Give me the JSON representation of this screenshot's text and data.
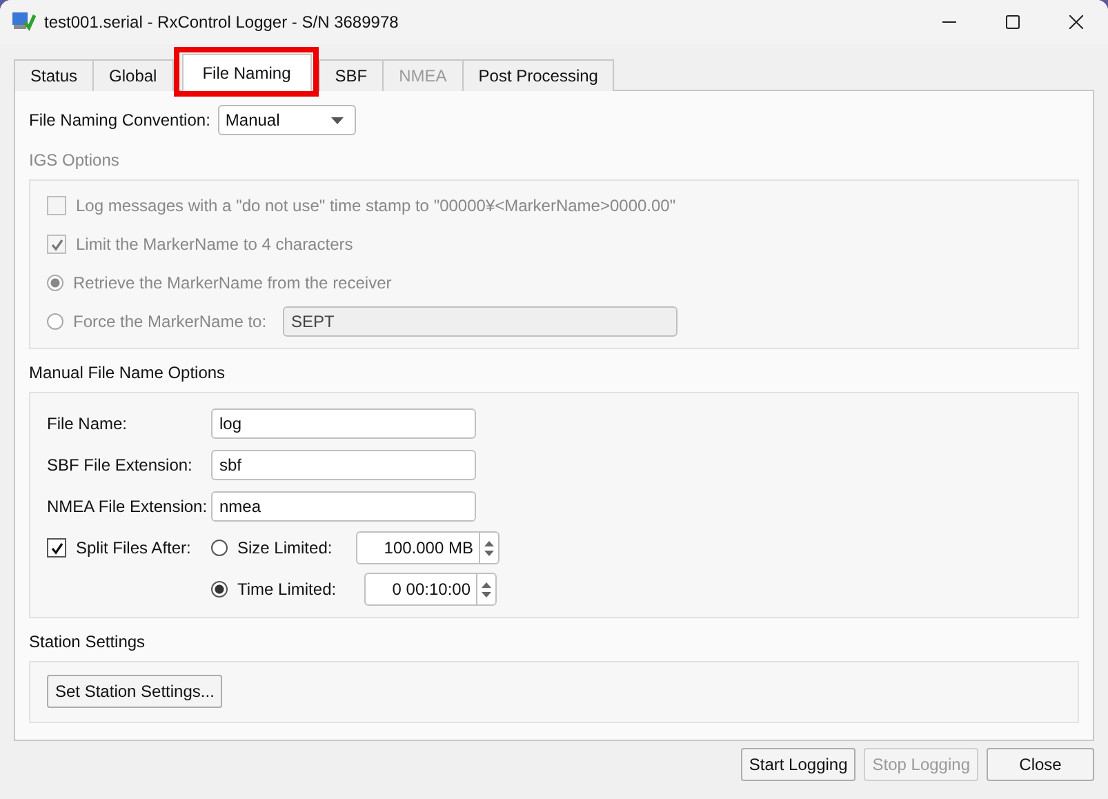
{
  "window": {
    "title": "test001.serial - RxControl Logger - S/N 3689978"
  },
  "tabs": [
    {
      "label": "Status",
      "selected": false,
      "disabled": false,
      "highlighted": false
    },
    {
      "label": "Global",
      "selected": false,
      "disabled": false,
      "highlighted": false
    },
    {
      "label": "File Naming",
      "selected": true,
      "disabled": false,
      "highlighted": true
    },
    {
      "label": "SBF",
      "selected": false,
      "disabled": false,
      "highlighted": false
    },
    {
      "label": "NMEA",
      "selected": false,
      "disabled": true,
      "highlighted": false
    },
    {
      "label": "Post Processing",
      "selected": false,
      "disabled": false,
      "highlighted": false
    }
  ],
  "convention": {
    "label": "File Naming Convention:",
    "value": "Manual"
  },
  "igs_options": {
    "title": "IGS Options",
    "disabled": true,
    "items": [
      {
        "kind": "checkbox",
        "label": "Log messages with a \"do not use\" time stamp to \"00000¥<MarkerName>0000.00\"",
        "checked": false
      },
      {
        "kind": "checkbox",
        "label": "Limit the MarkerName to 4 characters",
        "checked": true
      },
      {
        "kind": "radio",
        "label": "Retrieve the MarkerName from the receiver",
        "selected": true
      },
      {
        "kind": "radio",
        "label": "Force the MarkerName to:",
        "selected": false,
        "value": "SEPT"
      }
    ]
  },
  "manual_options": {
    "title": "Manual File Name Options",
    "fields": [
      {
        "label": "File Name:",
        "value": "log"
      },
      {
        "label": "SBF File Extension:",
        "value": "sbf"
      },
      {
        "label": "NMEA File Extension:",
        "value": "nmea"
      }
    ],
    "split": {
      "label": "Split Files After:",
      "checked": true
    },
    "limits": [
      {
        "label": "Size Limited:",
        "selected": false,
        "value": "100.000 MB"
      },
      {
        "label": "Time Limited:",
        "selected": true,
        "value": "0 00:10:00"
      }
    ]
  },
  "station_settings": {
    "title": "Station Settings",
    "button": "Set Station Settings..."
  },
  "buttons": [
    {
      "label": "Start Logging",
      "disabled": false
    },
    {
      "label": "Stop Logging",
      "disabled": true
    },
    {
      "label": "Close",
      "disabled": false
    }
  ]
}
